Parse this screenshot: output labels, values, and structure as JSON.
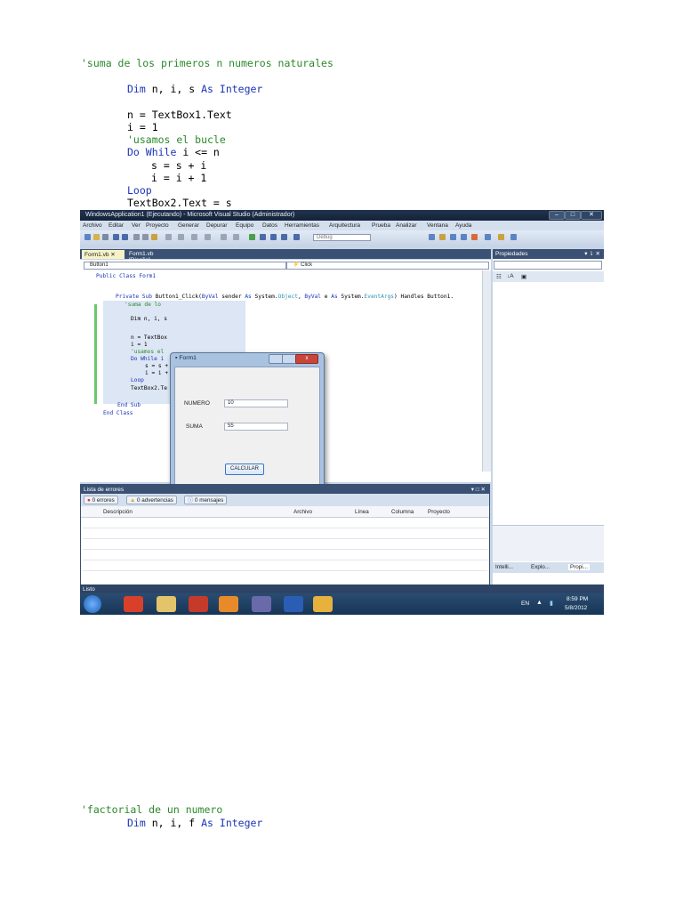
{
  "top_code": {
    "comment": "'suma de los primeros n numeros naturales",
    "dim_kw": "Dim",
    "dim_vars": " n, i, s ",
    "dim_as": "As",
    "dim_type": "Integer",
    "line_n": "n = TextBox1.Text",
    "line_i": "i = 1",
    "line_comment2": "'usamos el bucle",
    "do_kw": "Do While",
    "do_cond": " i <= n",
    "line_s": "s = s + i",
    "line_i2": "i = i + 1",
    "loop_kw": "Loop",
    "line_tb2": "TextBox2.Text = s"
  },
  "vs_window": {
    "title": "WindowsApplication1 (Ejecutando) - Microsoft Visual Studio (Administrador)",
    "menu": [
      "Archivo",
      "Editar",
      "Ver",
      "Proyecto",
      "Generar",
      "Depurar",
      "Equipo",
      "Datos",
      "Herramientas",
      "Arquitectura",
      "Prueba",
      "Analizar",
      "Ventana",
      "Ayuda"
    ],
    "config_combo": "Debug",
    "doc_tabs": [
      "Form1.vb",
      "Form1.vb [Diseño]"
    ],
    "object_combo": "Button1",
    "event_combo": "Click",
    "editor": {
      "l1": "Public Class Form1",
      "l2a": "Private Sub",
      "l2b": " Button1_Click(",
      "l2c": "ByVal",
      "l2d": " sender ",
      "l2e": "As",
      "l2f": " System.",
      "l2g": "Object",
      "l2h": ", ",
      "l2i": "ByVal",
      "l2j": " e ",
      "l2k": "As",
      "l2l": " System.",
      "l2m": "EventArgs",
      "l2n": ") Handles Button1.",
      "l3": "'suma de lo",
      "l4": "Dim n, i, s",
      "l5": "n = TextBox",
      "l6": "i = 1",
      "l7": "'usamos el",
      "l8": "Do While i",
      "l9": "s = s +",
      "l10": "i = i +",
      "l11": "Loop",
      "l12": "TextBox2.Te",
      "l13": "End Sub",
      "l14": "End Class"
    },
    "form1": {
      "title": "Form1",
      "label_numero": "NUMERO",
      "value_numero": "10",
      "label_suma": "SUMA",
      "value_suma": "55",
      "button": "CALCULAR"
    },
    "error_list": {
      "title": "Lista de errores",
      "errors": "0 errores",
      "warnings": "0 advertencias",
      "messages": "0 mensajes",
      "columns": [
        "Descripción",
        "Archivo",
        "Línea",
        "Columna",
        "Proyecto"
      ]
    },
    "properties": {
      "title": "Propiedades",
      "bottom_tabs": [
        "Intelli...",
        "Explo...",
        "Propi..."
      ]
    },
    "status": "Listo",
    "tray": {
      "lang": "EN",
      "time": "8:59 PM",
      "date": "5/8/2012"
    }
  },
  "bottom_code": {
    "comment": "'factorial de un numero",
    "dim_kw": "Dim",
    "dim_vars": " n, i, f ",
    "dim_as": "As",
    "dim_type": "Integer"
  }
}
